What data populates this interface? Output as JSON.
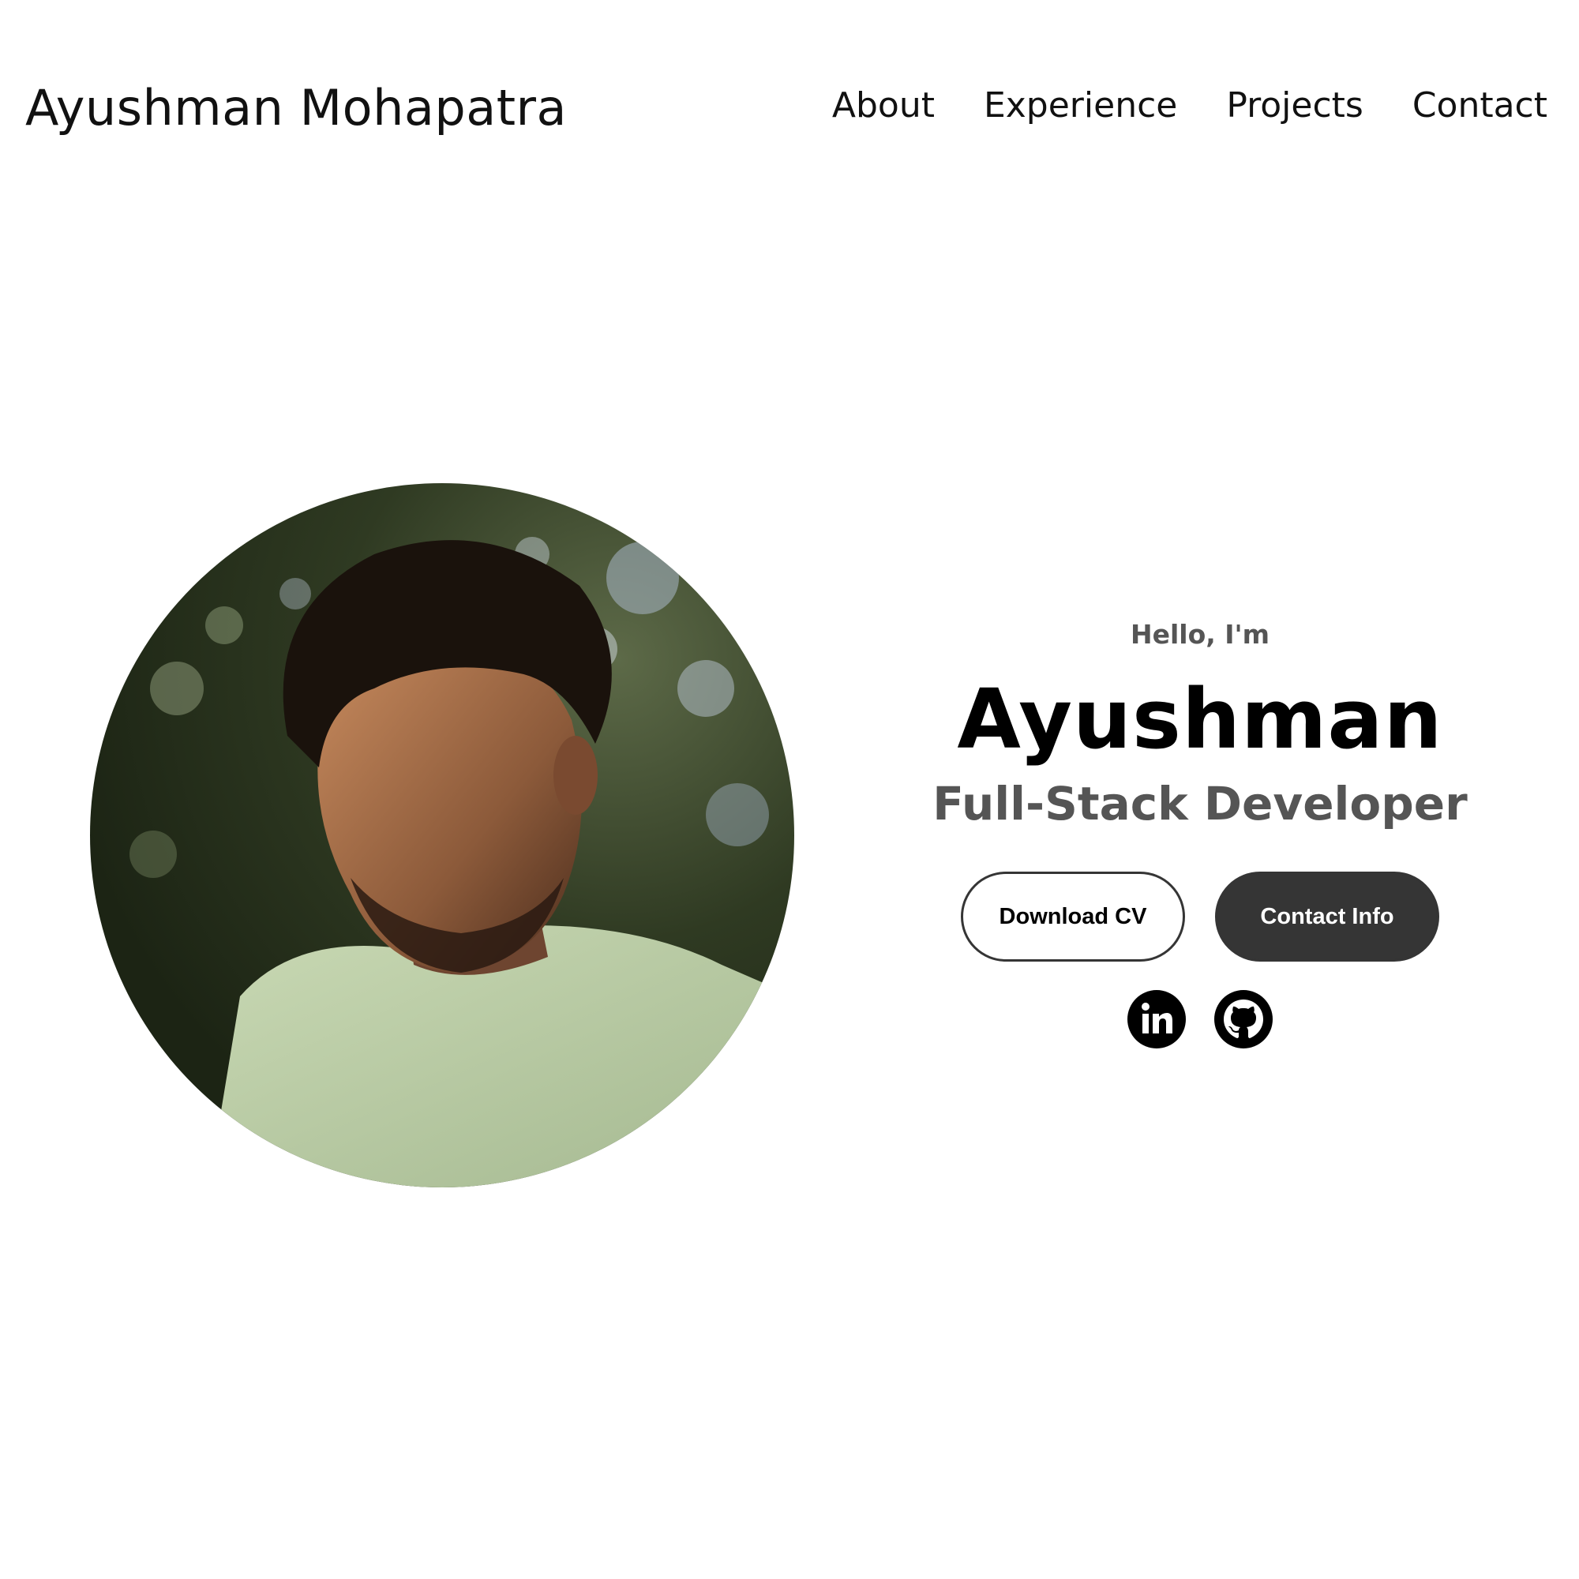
{
  "header": {
    "brand": "Ayushman Mohapatra",
    "nav": [
      "About",
      "Experience",
      "Projects",
      "Contact"
    ]
  },
  "hero": {
    "photo": "profile-photo",
    "greeting": "Hello, I'm",
    "name": "Ayushman",
    "role": "Full-Stack Developer",
    "buttons": {
      "download_cv": "Download CV",
      "contact_info": "Contact Info"
    },
    "socials": [
      {
        "icon": "linkedin-icon"
      },
      {
        "icon": "github-icon"
      }
    ]
  },
  "colors": {
    "background": "#ffffff",
    "text": "#000000",
    "muted_text": "#555555",
    "button_dark": "#353535"
  }
}
